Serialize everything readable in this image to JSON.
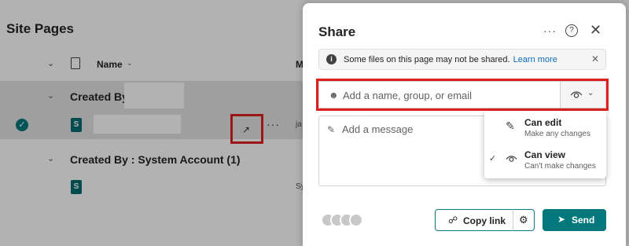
{
  "background": {
    "page_title": "Site Pages",
    "column_name": "Name",
    "column_m": "M",
    "groups": [
      {
        "label": "Created By"
      },
      {
        "label": "Created By : System Account (1)"
      }
    ],
    "rows": [
      {
        "trunc": "ja"
      },
      {
        "trunc": "Sy"
      }
    ]
  },
  "share_panel": {
    "title": "Share",
    "info_text": "Some files on this page may not be shared.",
    "info_link": "Learn more",
    "to_placeholder": "Add a name, group, or email",
    "message_placeholder": "Add a message",
    "permission_options": [
      {
        "title": "Can edit",
        "subtitle": "Make any changes",
        "selected": false,
        "icon": "pencil-icon"
      },
      {
        "title": "Can view",
        "subtitle": "Can't make changes",
        "selected": true,
        "icon": "eye-icon"
      }
    ],
    "copy_link_label": "Copy link",
    "send_label": "Send"
  },
  "colors": {
    "accent": "#03787c",
    "highlight_red": "#e0201f",
    "link": "#0f6cbd"
  }
}
